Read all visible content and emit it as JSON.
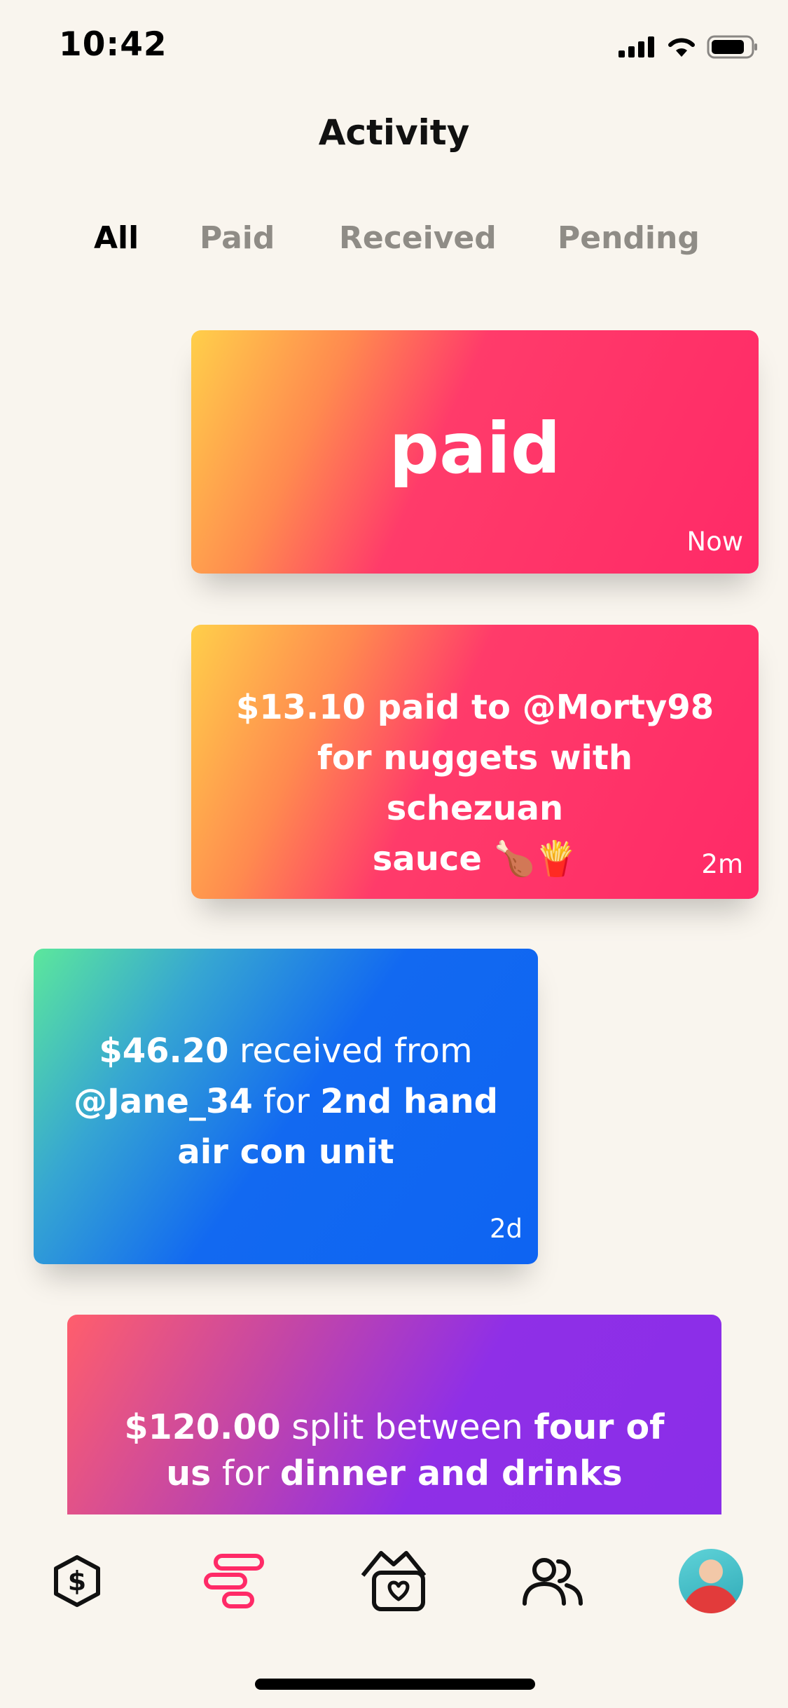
{
  "status_bar": {
    "time": "10:42"
  },
  "header": {
    "title": "Activity"
  },
  "filter_tabs": [
    {
      "label": "All",
      "active": true
    },
    {
      "label": "Paid",
      "active": false
    },
    {
      "label": "Received",
      "active": false
    },
    {
      "label": "Pending",
      "active": false
    }
  ],
  "cards": [
    {
      "type": "paid",
      "headline": "paid",
      "time": "Now",
      "colors": [
        "#FFCF4A",
        "#FF2A67"
      ]
    },
    {
      "type": "paid",
      "text_line1": "$13.10 paid to @Morty98",
      "text_line2": "for nuggets with schezuan",
      "text_line3": "sauce 🍗🍟",
      "time": "2m",
      "colors": [
        "#FFCF4A",
        "#FF2A67"
      ]
    },
    {
      "type": "received",
      "amount": "$46.20",
      "verb": " received from ",
      "user": "@Jane_34",
      "for_word": " for ",
      "item": "2nd hand air con unit",
      "time": "2d",
      "colors": [
        "#5CE79C",
        "#0E64F2"
      ]
    },
    {
      "type": "split",
      "amount": "$120.00",
      "verb": " split between ",
      "who": "four of us",
      "for_word": " for ",
      "item": "dinner and drinks",
      "colors": [
        "#FF5E6C",
        "#8A2EE8"
      ]
    }
  ],
  "tab_bar": {
    "items": [
      {
        "icon": "dollar-hexagon-icon"
      },
      {
        "icon": "activity-bars-icon",
        "active": true,
        "color": "#FF2A67"
      },
      {
        "icon": "heart-wallet-icon"
      },
      {
        "icon": "people-icon"
      },
      {
        "icon": "avatar"
      }
    ]
  }
}
